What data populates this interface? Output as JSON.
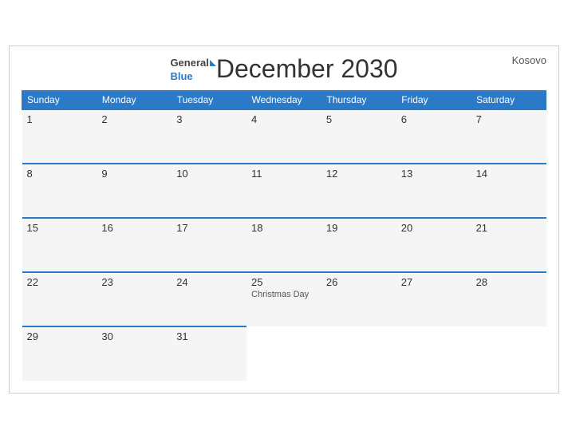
{
  "header": {
    "title": "December 2030",
    "logo_general": "General",
    "logo_blue": "Blue",
    "country": "Kosovo"
  },
  "weekdays": [
    "Sunday",
    "Monday",
    "Tuesday",
    "Wednesday",
    "Thursday",
    "Friday",
    "Saturday"
  ],
  "weeks": [
    [
      {
        "day": "1",
        "holiday": ""
      },
      {
        "day": "2",
        "holiday": ""
      },
      {
        "day": "3",
        "holiday": ""
      },
      {
        "day": "4",
        "holiday": ""
      },
      {
        "day": "5",
        "holiday": ""
      },
      {
        "day": "6",
        "holiday": ""
      },
      {
        "day": "7",
        "holiday": ""
      }
    ],
    [
      {
        "day": "8",
        "holiday": ""
      },
      {
        "day": "9",
        "holiday": ""
      },
      {
        "day": "10",
        "holiday": ""
      },
      {
        "day": "11",
        "holiday": ""
      },
      {
        "day": "12",
        "holiday": ""
      },
      {
        "day": "13",
        "holiday": ""
      },
      {
        "day": "14",
        "holiday": ""
      }
    ],
    [
      {
        "day": "15",
        "holiday": ""
      },
      {
        "day": "16",
        "holiday": ""
      },
      {
        "day": "17",
        "holiday": ""
      },
      {
        "day": "18",
        "holiday": ""
      },
      {
        "day": "19",
        "holiday": ""
      },
      {
        "day": "20",
        "holiday": ""
      },
      {
        "day": "21",
        "holiday": ""
      }
    ],
    [
      {
        "day": "22",
        "holiday": ""
      },
      {
        "day": "23",
        "holiday": ""
      },
      {
        "day": "24",
        "holiday": ""
      },
      {
        "day": "25",
        "holiday": "Christmas Day"
      },
      {
        "day": "26",
        "holiday": ""
      },
      {
        "day": "27",
        "holiday": ""
      },
      {
        "day": "28",
        "holiday": ""
      }
    ],
    [
      {
        "day": "29",
        "holiday": ""
      },
      {
        "day": "30",
        "holiday": ""
      },
      {
        "day": "31",
        "holiday": ""
      },
      {
        "day": "",
        "holiday": ""
      },
      {
        "day": "",
        "holiday": ""
      },
      {
        "day": "",
        "holiday": ""
      },
      {
        "day": "",
        "holiday": ""
      }
    ]
  ]
}
